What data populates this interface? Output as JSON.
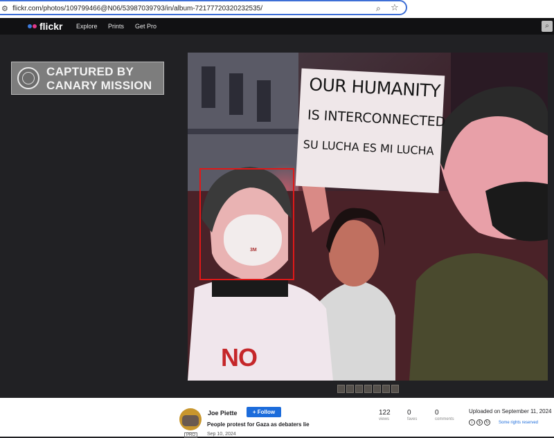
{
  "browser": {
    "url": "flickr.com/photos/109799466@N06/53987039793/in/album-72177720320232535/",
    "tune_icon": "tune-icon",
    "zoom_icon": "zoom-icon",
    "star_icon": "bookmark-star-icon"
  },
  "nav": {
    "logo": "flickr",
    "links": [
      "Explore",
      "Prints",
      "Get Pro"
    ],
    "search_icon": "search-icon"
  },
  "badge": {
    "line1": "CAPTURED BY",
    "line2": "CANARY MISSION"
  },
  "photo": {
    "sign_line1": "OUR HUMANITY",
    "sign_line2": "IS INTERCONNECTED",
    "sign_line3": "SU LUCHA ES MI LUCHA",
    "mask_text": "3M",
    "shirt_text": "NO",
    "highlight_color": "#e01818"
  },
  "info": {
    "author": "Joe Piette",
    "pro_badge": "PRO",
    "follow_label": "+ Follow",
    "title": "People protest for Gaza as debaters lie",
    "date": "Sep 10, 2024",
    "stats": [
      {
        "num": "122",
        "label": "views"
      },
      {
        "num": "0",
        "label": "faves"
      },
      {
        "num": "0",
        "label": "comments"
      }
    ],
    "uploaded": "Uploaded on September 11, 2024",
    "license": "Some rights reserved"
  },
  "colors": {
    "nav_bg": "#111113",
    "page_bg": "#212124",
    "follow_blue": "#1c6cdb"
  }
}
